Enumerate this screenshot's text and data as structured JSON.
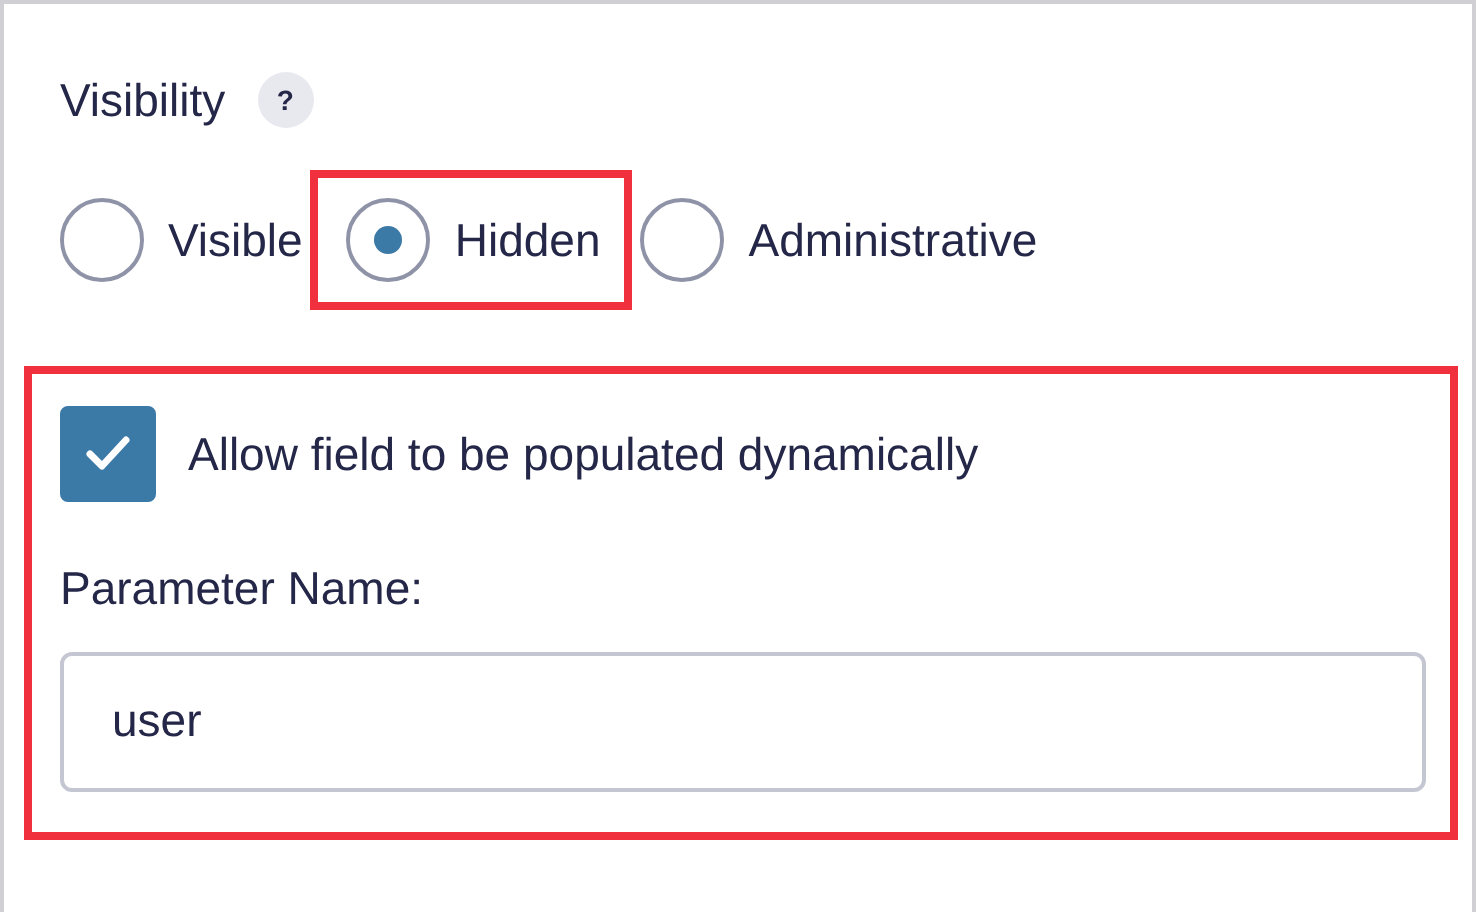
{
  "visibility": {
    "label": "Visibility",
    "help": "?",
    "options": [
      {
        "label": "Visible",
        "selected": false,
        "highlighted": false
      },
      {
        "label": "Hidden",
        "selected": true,
        "highlighted": true
      },
      {
        "label": "Administrative",
        "selected": false,
        "highlighted": false
      }
    ]
  },
  "dynamic_section": {
    "highlighted": true,
    "checkbox": {
      "label": "Allow field to be populated dynamically",
      "checked": true
    },
    "parameter": {
      "label": "Parameter Name:",
      "value": "user"
    }
  }
}
